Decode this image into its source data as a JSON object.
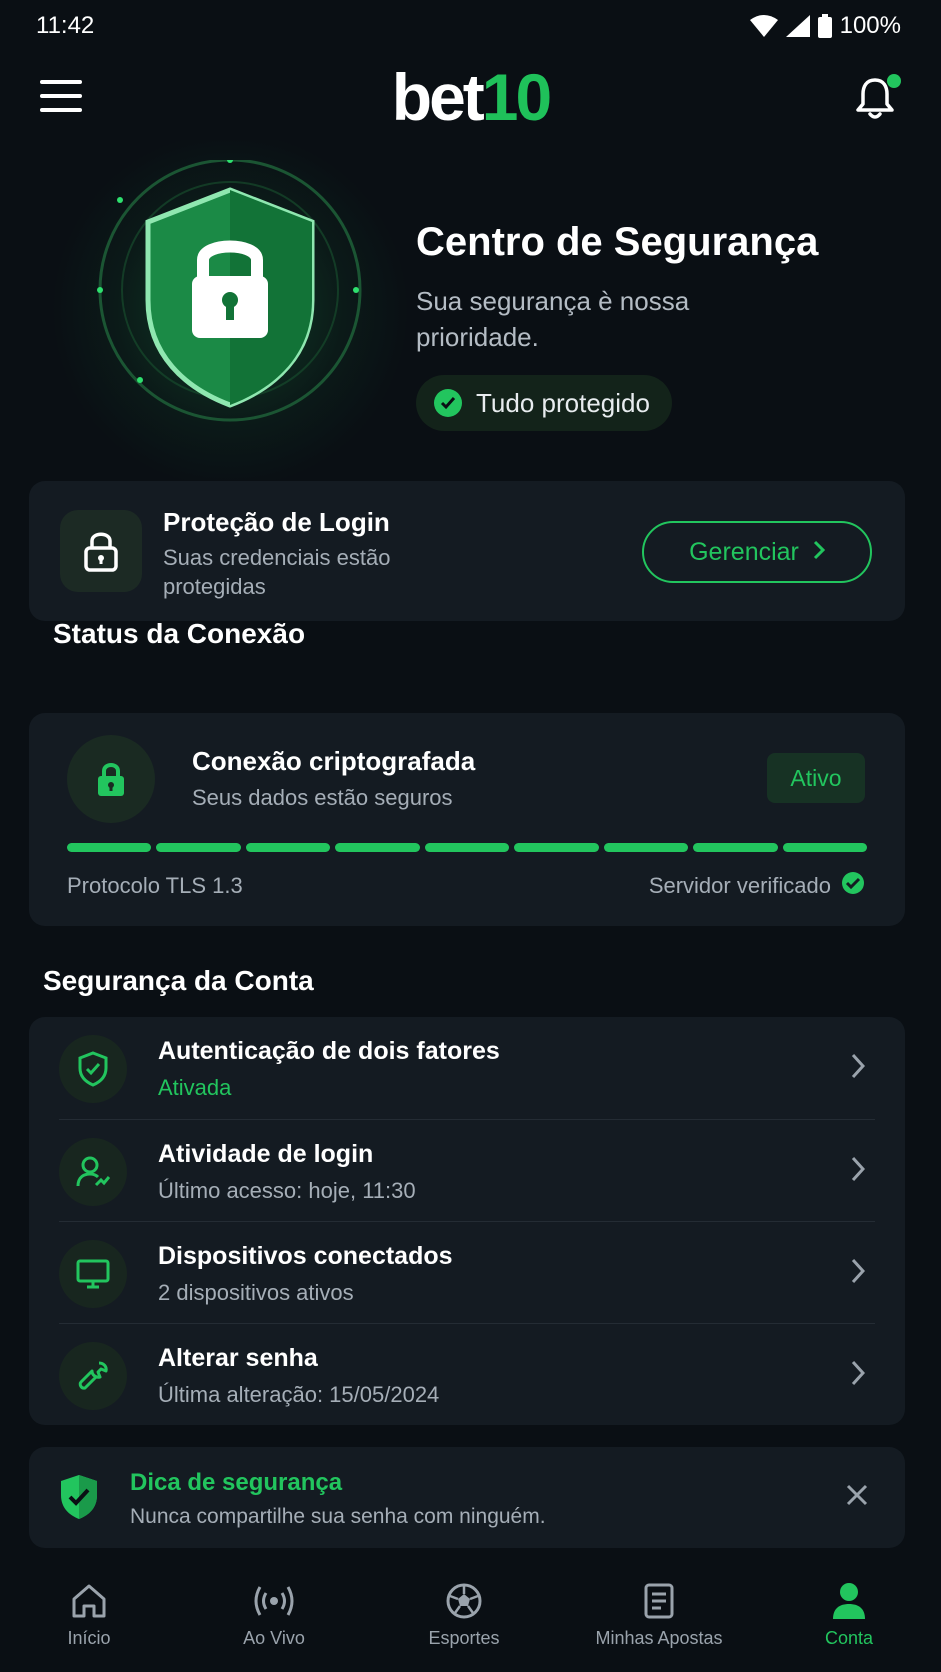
{
  "status_bar": {
    "time": "11:42",
    "battery": "100%"
  },
  "app_bar": {
    "logo_part1": "bet",
    "logo_part2": "10"
  },
  "hero": {
    "title": "Centro de Segurança",
    "subtitle": "Sua segurança è nossa prioridade.",
    "badge": "Tudo protegido"
  },
  "login_protection": {
    "title": "Proteção de Login",
    "subtitle": "Suas credenciais estão protegidas",
    "button": "Gerenciar"
  },
  "connection": {
    "section_title": "Status da Conexão",
    "title": "Conexão criptografada",
    "subtitle": "Seus dados estão seguros",
    "badge": "Ativo",
    "progress_segments_on": 9,
    "progress_segments_total": 9,
    "protocol": "Protocolo TLS 1.3",
    "server": "Servidor verificado"
  },
  "account": {
    "section_title": "Segurança da Conta",
    "items": [
      {
        "title": "Autenticação de dois fatores",
        "subtitle": "Ativada",
        "icon": "shield-check-icon"
      },
      {
        "title": "Atividade de login",
        "subtitle": "Último acesso: hoje, 11:30",
        "icon": "user-activity-icon"
      },
      {
        "title": "Dispositivos conectados",
        "subtitle": "2 dispositivos ativos",
        "icon": "monitor-icon"
      },
      {
        "title": "Alterar senha",
        "subtitle": "Última alteração: 15/05/2024",
        "icon": "wrench-icon"
      }
    ]
  },
  "tip": {
    "title": "Dica de segurança",
    "text": "Nunca compartilhe sua senha com ninguém."
  },
  "bottom_nav": [
    {
      "label": "Início",
      "icon": "home-icon"
    },
    {
      "label": "Ao Vivo",
      "icon": "live-icon"
    },
    {
      "label": "Esportes",
      "icon": "soccer-ball-icon"
    },
    {
      "label": "Minhas Apostas",
      "icon": "bet-slip-icon"
    },
    {
      "label": "Conta",
      "icon": "user-icon",
      "active": true
    }
  ],
  "colors": {
    "accent": "#22c55e",
    "background": "#0a0f14",
    "card": "#141b22"
  }
}
